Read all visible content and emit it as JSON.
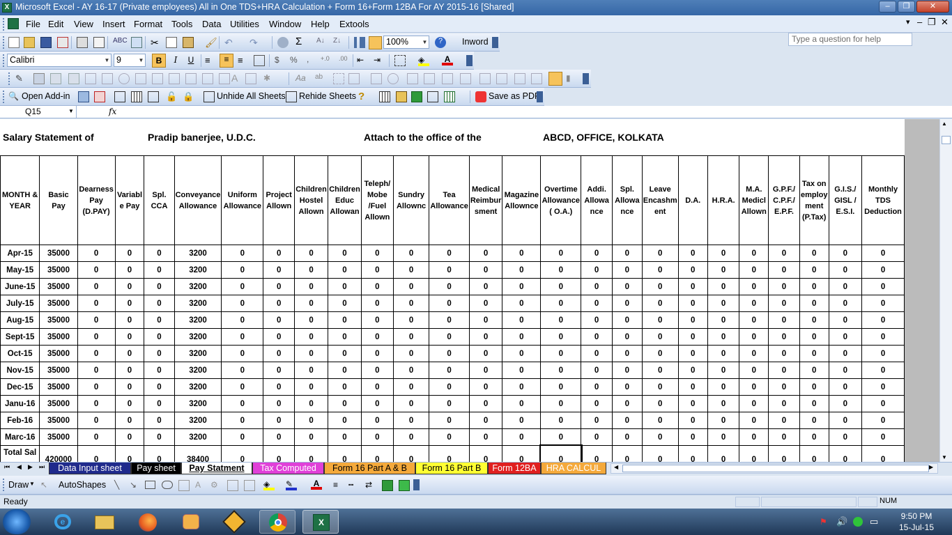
{
  "window": {
    "title": "Microsoft Excel - AY 16-17 (Private employees)  All in One TDS+HRA Calculation + Form 16+Form 12BA For AY 2015-16  [Shared]"
  },
  "menu": {
    "items": [
      "File",
      "Edit",
      "View",
      "Insert",
      "Format",
      "Tools",
      "Data",
      "Utilities",
      "Window",
      "Help",
      "Extools"
    ],
    "help_placeholder": "Type a question for help"
  },
  "toolbar": {
    "zoom": "100%",
    "inword": "Inword",
    "font": "Calibri",
    "size": "9"
  },
  "addins": {
    "open_addin": "Open Add-in",
    "unhide": "Unhide All Sheets",
    "rehide": "Rehide Sheets",
    "save_pdf": "Save as PDF"
  },
  "formula": {
    "namebox": "Q15",
    "fx": "fx"
  },
  "sheet": {
    "header": {
      "label1": "Salary Statement of",
      "name": "Pradip banerjee, U.D.C.",
      "label2": "Attach to the office of the",
      "office": "ABCD, OFFICE, KOLKATA"
    },
    "columns": [
      "MONTH & YEAR",
      "Basic Pay",
      "Dearness Pay (D.PAY)",
      "Variabl e Pay",
      "Spl. CCA",
      "Conveyance Allowance",
      "Uniform Allowance",
      "Project Allown",
      "Children Hostel Allown",
      "Children Educ Allowan",
      "Teleph/ Mobe /Fuel Allown",
      "Sundry Allownc",
      "Tea Allowance",
      "Medical Reimbur sment",
      "Magazine Allownce",
      "Overtime Allowance ( O.A.)",
      "Addi. Allowa nce",
      "Spl. Allowa nce",
      "Leave Encashm ent",
      "D.A.",
      "H.R.A.",
      "M.A. Medicl Allown",
      "G.P.F./ C.P.F./ E.P.F.",
      "Tax on employ ment (P.Tax)",
      "G.I.S./ GISL / E.S.I.",
      "Monthly TDS Deduction"
    ],
    "rows": [
      [
        "Apr-15",
        "35000",
        "0",
        "0",
        "0",
        "3200",
        "0",
        "0",
        "0",
        "0",
        "0",
        "0",
        "0",
        "0",
        "0",
        "0",
        "0",
        "0",
        "0",
        "0",
        "0",
        "0",
        "0",
        "0",
        "0",
        "0"
      ],
      [
        "May-15",
        "35000",
        "0",
        "0",
        "0",
        "3200",
        "0",
        "0",
        "0",
        "0",
        "0",
        "0",
        "0",
        "0",
        "0",
        "0",
        "0",
        "0",
        "0",
        "0",
        "0",
        "0",
        "0",
        "0",
        "0",
        "0"
      ],
      [
        "June-15",
        "35000",
        "0",
        "0",
        "0",
        "3200",
        "0",
        "0",
        "0",
        "0",
        "0",
        "0",
        "0",
        "0",
        "0",
        "0",
        "0",
        "0",
        "0",
        "0",
        "0",
        "0",
        "0",
        "0",
        "0",
        "0"
      ],
      [
        "July-15",
        "35000",
        "0",
        "0",
        "0",
        "3200",
        "0",
        "0",
        "0",
        "0",
        "0",
        "0",
        "0",
        "0",
        "0",
        "0",
        "0",
        "0",
        "0",
        "0",
        "0",
        "0",
        "0",
        "0",
        "0",
        "0"
      ],
      [
        "Aug-15",
        "35000",
        "0",
        "0",
        "0",
        "3200",
        "0",
        "0",
        "0",
        "0",
        "0",
        "0",
        "0",
        "0",
        "0",
        "0",
        "0",
        "0",
        "0",
        "0",
        "0",
        "0",
        "0",
        "0",
        "0",
        "0"
      ],
      [
        "Sept-15",
        "35000",
        "0",
        "0",
        "0",
        "3200",
        "0",
        "0",
        "0",
        "0",
        "0",
        "0",
        "0",
        "0",
        "0",
        "0",
        "0",
        "0",
        "0",
        "0",
        "0",
        "0",
        "0",
        "0",
        "0",
        "0"
      ],
      [
        "Oct-15",
        "35000",
        "0",
        "0",
        "0",
        "3200",
        "0",
        "0",
        "0",
        "0",
        "0",
        "0",
        "0",
        "0",
        "0",
        "0",
        "0",
        "0",
        "0",
        "0",
        "0",
        "0",
        "0",
        "0",
        "0",
        "0"
      ],
      [
        "Nov-15",
        "35000",
        "0",
        "0",
        "0",
        "3200",
        "0",
        "0",
        "0",
        "0",
        "0",
        "0",
        "0",
        "0",
        "0",
        "0",
        "0",
        "0",
        "0",
        "0",
        "0",
        "0",
        "0",
        "0",
        "0",
        "0"
      ],
      [
        "Dec-15",
        "35000",
        "0",
        "0",
        "0",
        "3200",
        "0",
        "0",
        "0",
        "0",
        "0",
        "0",
        "0",
        "0",
        "0",
        "0",
        "0",
        "0",
        "0",
        "0",
        "0",
        "0",
        "0",
        "0",
        "0",
        "0"
      ],
      [
        "Janu-16",
        "35000",
        "0",
        "0",
        "0",
        "3200",
        "0",
        "0",
        "0",
        "0",
        "0",
        "0",
        "0",
        "0",
        "0",
        "0",
        "0",
        "0",
        "0",
        "0",
        "0",
        "0",
        "0",
        "0",
        "0",
        "0"
      ],
      [
        "Feb-16",
        "35000",
        "0",
        "0",
        "0",
        "3200",
        "0",
        "0",
        "0",
        "0",
        "0",
        "0",
        "0",
        "0",
        "0",
        "0",
        "0",
        "0",
        "0",
        "0",
        "0",
        "0",
        "0",
        "0",
        "0",
        "0"
      ],
      [
        "Marc-16",
        "35000",
        "0",
        "0",
        "0",
        "3200",
        "0",
        "0",
        "0",
        "0",
        "0",
        "0",
        "0",
        "0",
        "0",
        "0",
        "0",
        "0",
        "0",
        "0",
        "0",
        "0",
        "0",
        "0",
        "0",
        "0"
      ],
      [
        "Total Sal",
        "420000",
        "0",
        "0",
        "0",
        "38400",
        "0",
        "0",
        "0",
        "0",
        "0",
        "0",
        "0",
        "0",
        "0",
        "0",
        "0",
        "0",
        "0",
        "0",
        "0",
        "0",
        "0",
        "0",
        "0",
        "0"
      ]
    ]
  },
  "tabs": [
    {
      "label": "Data Input sheet",
      "bg": "#1f2a8c",
      "fg": "#ffffff"
    },
    {
      "label": "Pay sheet",
      "bg": "#000000",
      "fg": "#ffffff"
    },
    {
      "label": "Pay Statment",
      "bg": "#ffffff",
      "fg": "#000000",
      "active": true
    },
    {
      "label": "Tax Computed",
      "bg": "#e040d8",
      "fg": "#ffffff"
    },
    {
      "label": "Form 16 Part A & B",
      "bg": "#f4a93b",
      "fg": "#000000"
    },
    {
      "label": "Form 16 Part B",
      "bg": "#ffff33",
      "fg": "#000000"
    },
    {
      "label": "Form 12BA",
      "bg": "#e02020",
      "fg": "#ffffff"
    },
    {
      "label": "HRA CALCUL",
      "bg": "#f4a93b",
      "fg": "#ffffff"
    }
  ],
  "draw": {
    "draw": "Draw",
    "autoshapes": "AutoShapes"
  },
  "status": {
    "ready": "Ready",
    "num": "NUM"
  },
  "clock": {
    "time": "9:50 PM",
    "date": "15-Jul-15"
  }
}
